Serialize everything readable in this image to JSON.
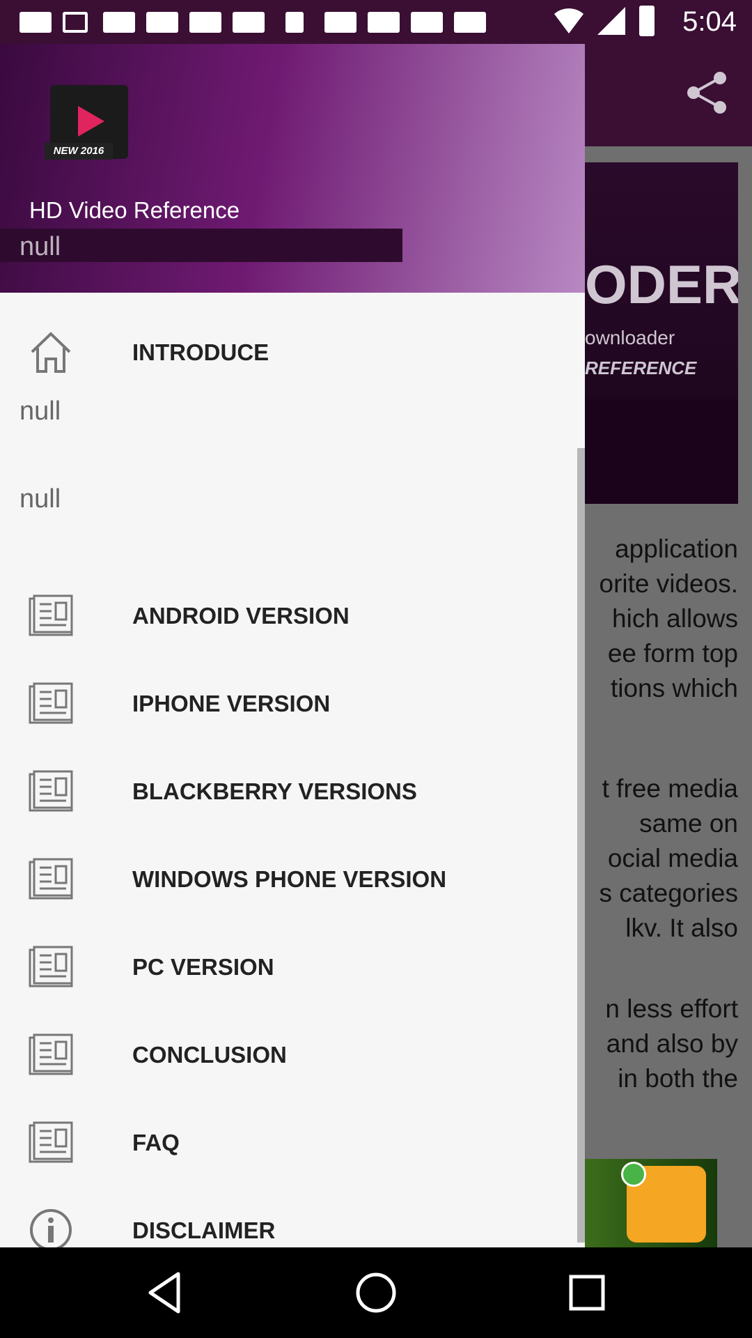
{
  "status_bar": {
    "time": "5:04",
    "icons": [
      "message-icon",
      "facebook-icon",
      "notification-icon",
      "notification-icon",
      "notification-icon",
      "notification-icon",
      "microscope-icon",
      "notification-icon",
      "notification-icon",
      "notification-icon",
      "notification-icon",
      "wifi-icon",
      "signal-icon",
      "battery-icon"
    ]
  },
  "background_app": {
    "banner": {
      "title": "ODER",
      "sub1": "ownloader",
      "sub2": "REFERENCE"
    },
    "text_lines_1": [
      " application",
      "orite videos.",
      "hich allows",
      "ee form top",
      "tions which"
    ],
    "text_lines_2": [
      "t free media",
      " same on",
      "ocial media",
      "s categories",
      "lkv. It also"
    ],
    "text_lines_3": [
      "n less effort",
      "and also by",
      "in both the"
    ]
  },
  "drawer": {
    "header": {
      "logo_badge": "NEW 2016",
      "title": "HD Video Reference",
      "subtitle": "null"
    },
    "items": [
      {
        "label": "INTRODUCE",
        "icon": "home-icon"
      },
      {
        "label": "ANDROID VERSION",
        "icon": "document-icon"
      },
      {
        "label": "IPHONE VERSION",
        "icon": "document-icon"
      },
      {
        "label": "BLACKBERRY VERSIONS",
        "icon": "document-icon"
      },
      {
        "label": "WINDOWS PHONE VERSION",
        "icon": "document-icon"
      },
      {
        "label": "PC VERSION",
        "icon": "document-icon"
      },
      {
        "label": "CONCLUSION",
        "icon": "document-icon"
      },
      {
        "label": "FAQ",
        "icon": "document-icon"
      },
      {
        "label": "DISCLAIMER",
        "icon": "info-icon"
      }
    ],
    "null_labels": [
      "null",
      "null"
    ]
  },
  "colors": {
    "header_dark": "#3a0a3f",
    "header_light": "#b889c3",
    "drawer_bg": "#f6f6f6",
    "text": "#222222"
  }
}
